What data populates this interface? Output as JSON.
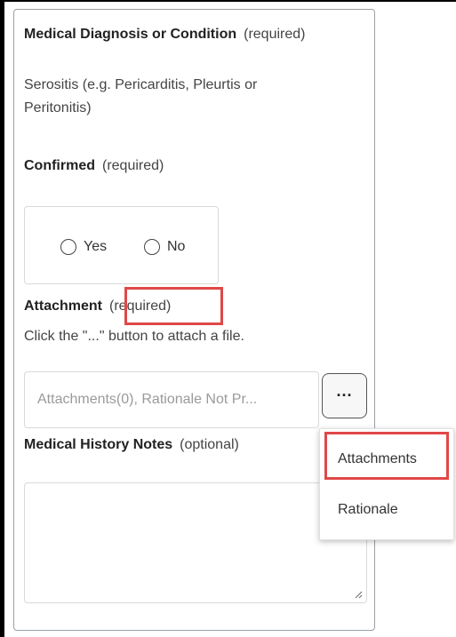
{
  "diagnosis": {
    "label": "Medical Diagnosis or Condition",
    "qualifier": "(required)",
    "value_line1": "Serositis (e.g. Pericarditis, Pleurtis or",
    "value_line2": "Peritonitis)"
  },
  "confirmed": {
    "label": "Confirmed",
    "qualifier": "(required)",
    "options": [
      "Yes",
      "No"
    ]
  },
  "attachment": {
    "label": "Attachment",
    "qualifier": "(required)",
    "hint": "Click the \"...\" button to attach a file.",
    "input_value": "Attachments(0), Rationale Not Pr...",
    "button_label": "..."
  },
  "menu": {
    "items": [
      "Attachments",
      "Rationale"
    ]
  },
  "history": {
    "label": "Medical History Notes",
    "qualifier": "(optional)"
  },
  "colors": {
    "highlight": "#e04848",
    "panel_border": "#9aa0a6"
  }
}
